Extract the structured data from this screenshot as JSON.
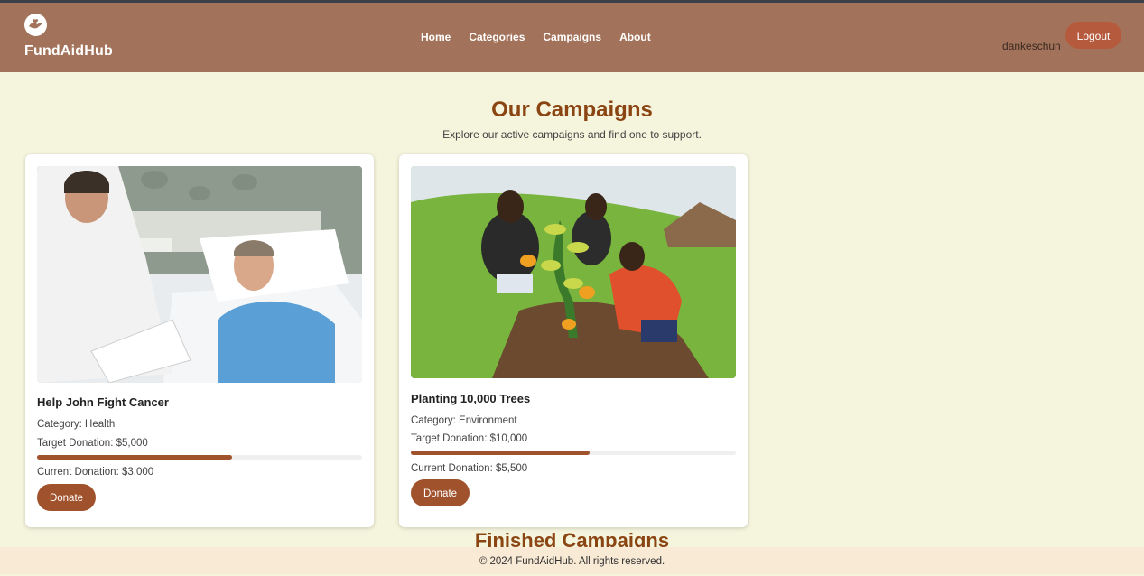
{
  "header": {
    "brand": "FundAidHub",
    "nav": [
      "Home",
      "Categories",
      "Campaigns",
      "About"
    ],
    "username": "dankeschun",
    "logout_label": "Logout",
    "bg_color": "#a2725a"
  },
  "main": {
    "title": "Our Campaigns",
    "subtitle": "Explore our active campaigns and find one to support.",
    "campaigns": [
      {
        "title": "Help John Fight Cancer",
        "category": "Category: Health",
        "target": "Target Donation: $5,000",
        "current": "Current Donation: $3,000",
        "progress": 0.6,
        "donate_label": "Donate"
      },
      {
        "title": "Planting 10,000 Trees",
        "category": "Category: Environment",
        "target": "Target Donation: $10,000",
        "current": "Current Donation: $5,500",
        "progress": 0.55,
        "donate_label": "Donate"
      }
    ],
    "finished_title": "Finished Campaigns"
  },
  "footer": {
    "text": "© 2024 FundAidHub. All rights reserved."
  },
  "colors": {
    "accent": "#a0522d",
    "heading": "#8b4513",
    "page_bg": "#f5f4dc"
  }
}
